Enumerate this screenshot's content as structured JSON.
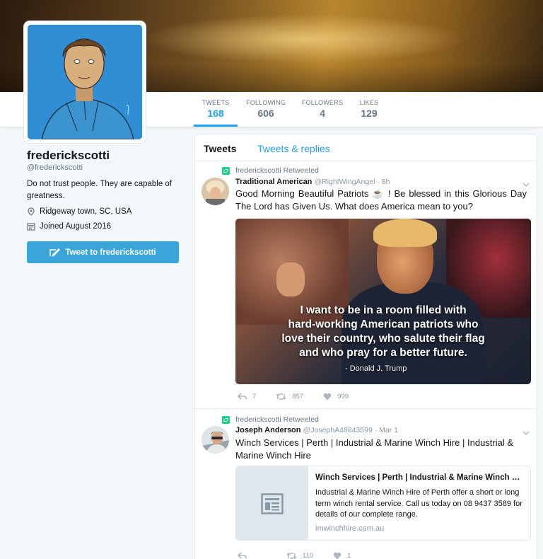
{
  "profile": {
    "name": "frederickscotti",
    "handle": "@frederickscotti",
    "bio": "Do not trust people. They are capable of greatness.",
    "location": "Ridgeway town, SC, USA",
    "joined": "Joined August 2016",
    "tweet_to_label": "Tweet to frederickscotti"
  },
  "stats": [
    {
      "label": "TWEETS",
      "value": "168"
    },
    {
      "label": "FOLLOWING",
      "value": "606"
    },
    {
      "label": "FOLLOWERS",
      "value": "4"
    },
    {
      "label": "LIKES",
      "value": "129"
    }
  ],
  "timeline_tabs": {
    "tweets": "Tweets",
    "replies": "Tweets & replies"
  },
  "tweets": [
    {
      "retweet_by": "frederickscotti Retweeted",
      "name": "Traditional American",
      "handle_time": "@RightWingAngel · 8h",
      "text": "Good Morning Beautiful Patriots ☕ ! Be blessed in this Glorious Day The Lord has Given Us. What does America mean to you?",
      "media_quote_lines": [
        "I want to be in a room filled with",
        "hard-working American patriots who",
        "love their country, who salute their flag",
        "and who pray for a better future."
      ],
      "media_attr": "- Donald J. Trump",
      "replies": "7",
      "retweets": "857",
      "likes": "999"
    },
    {
      "retweet_by": "frederickscotti Retweeted",
      "name": "Joseph Anderson",
      "handle_time": "@JosephA48843599 · Mar 1",
      "text": "Winch Services | Perth | Industrial & Marine Winch Hire | Industrial & Marine Winch Hire",
      "card_title": "Winch Services | Perth | Industrial & Marine Winch Hire...",
      "card_desc": "Industrial & Marine Winch Hire of Perth offer a short or long term winch rental service. Call us today on 08 9437 3589 for details of our complete range.",
      "card_url": "imwinchhire.com.au",
      "replies": "",
      "retweets": "110",
      "likes": "1"
    }
  ],
  "colors": {
    "accent": "#1da1f2",
    "button": "#3aa5d8",
    "retweet_green": "#19cf86"
  }
}
